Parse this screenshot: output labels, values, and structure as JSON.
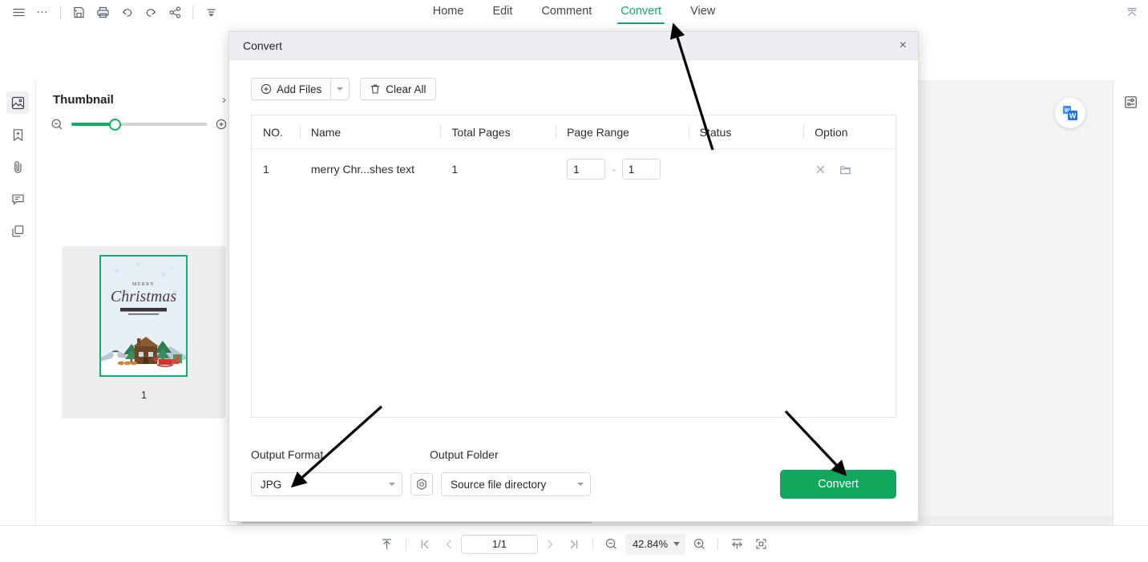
{
  "window": {
    "quick_access": [
      {
        "name": "menu-icon",
        "label": "Menu"
      },
      {
        "name": "more-icon",
        "label": "..."
      },
      {
        "name": "save-icon",
        "label": "Save"
      },
      {
        "name": "print-icon",
        "label": "Print"
      },
      {
        "name": "undo-icon",
        "label": "Undo"
      },
      {
        "name": "redo-icon",
        "label": "Redo"
      },
      {
        "name": "share-icon",
        "label": "Share"
      },
      {
        "name": "customize-toolbar-icon",
        "label": "Customize"
      }
    ],
    "collapse_ribbon_label": "Collapse"
  },
  "tabs": [
    {
      "label": "Home",
      "active": false
    },
    {
      "label": "Edit",
      "active": false
    },
    {
      "label": "Comment",
      "active": false
    },
    {
      "label": "Convert",
      "active": true
    },
    {
      "label": "View",
      "active": false
    }
  ],
  "accent_color": "#0fa968",
  "convert_button_color": "#11a85e",
  "sidebar": {
    "items": [
      {
        "name": "thumbnail-panel-icon",
        "label": "Thumbnail",
        "selected": true
      },
      {
        "name": "bookmark-panel-icon",
        "label": "Bookmark",
        "selected": false
      },
      {
        "name": "attachment-panel-icon",
        "label": "Attachment",
        "selected": false
      },
      {
        "name": "comment-panel-icon",
        "label": "Comment",
        "selected": false
      },
      {
        "name": "layers-panel-icon",
        "label": "Layers",
        "selected": false
      }
    ]
  },
  "thumbnail_panel": {
    "title": "Thumbnail",
    "collapse_label": "›",
    "zoom_out_label": "Zoom out",
    "zoom_in_label": "Zoom in",
    "zoom_value": 28,
    "page_label": "1"
  },
  "document": {
    "float_tool_label": "Word converter",
    "right_panel_icon": "properties-panel-icon"
  },
  "dialog": {
    "title": "Convert",
    "close_label": "×",
    "add_files_label": "Add Files",
    "add_files_caret": "▾",
    "clear_all_label": "Clear All",
    "columns": [
      "NO.",
      "Name",
      "Total Pages",
      "Page Range",
      "Status",
      "Option"
    ],
    "rows": [
      {
        "no": "1",
        "name": "merry Chr...shes text",
        "total_pages": "1",
        "range_from": "1",
        "range_to": "1",
        "range_separator": "-",
        "status": "",
        "remove_label": "Remove",
        "open_folder_label": "Open folder"
      }
    ],
    "output_format_label": "Output Format",
    "output_folder_label": "Output Folder",
    "output_format_value": "JPG",
    "output_folder_value": "Source file directory",
    "settings_label": "Settings",
    "convert_label": "Convert"
  },
  "statusbar": {
    "fit_top_label": "Scroll to top",
    "first_page_label": "First page",
    "prev_page_label": "Previous page",
    "page_indicator": "1/1",
    "next_page_label": "Next page",
    "last_page_label": "Last page",
    "zoom_out_label": "Zoom out",
    "zoom_value": "42.84%",
    "zoom_caret": "▾",
    "zoom_in_label": "Zoom in",
    "fit_width_label": "Fit width",
    "fit_page_label": "Fit page"
  }
}
